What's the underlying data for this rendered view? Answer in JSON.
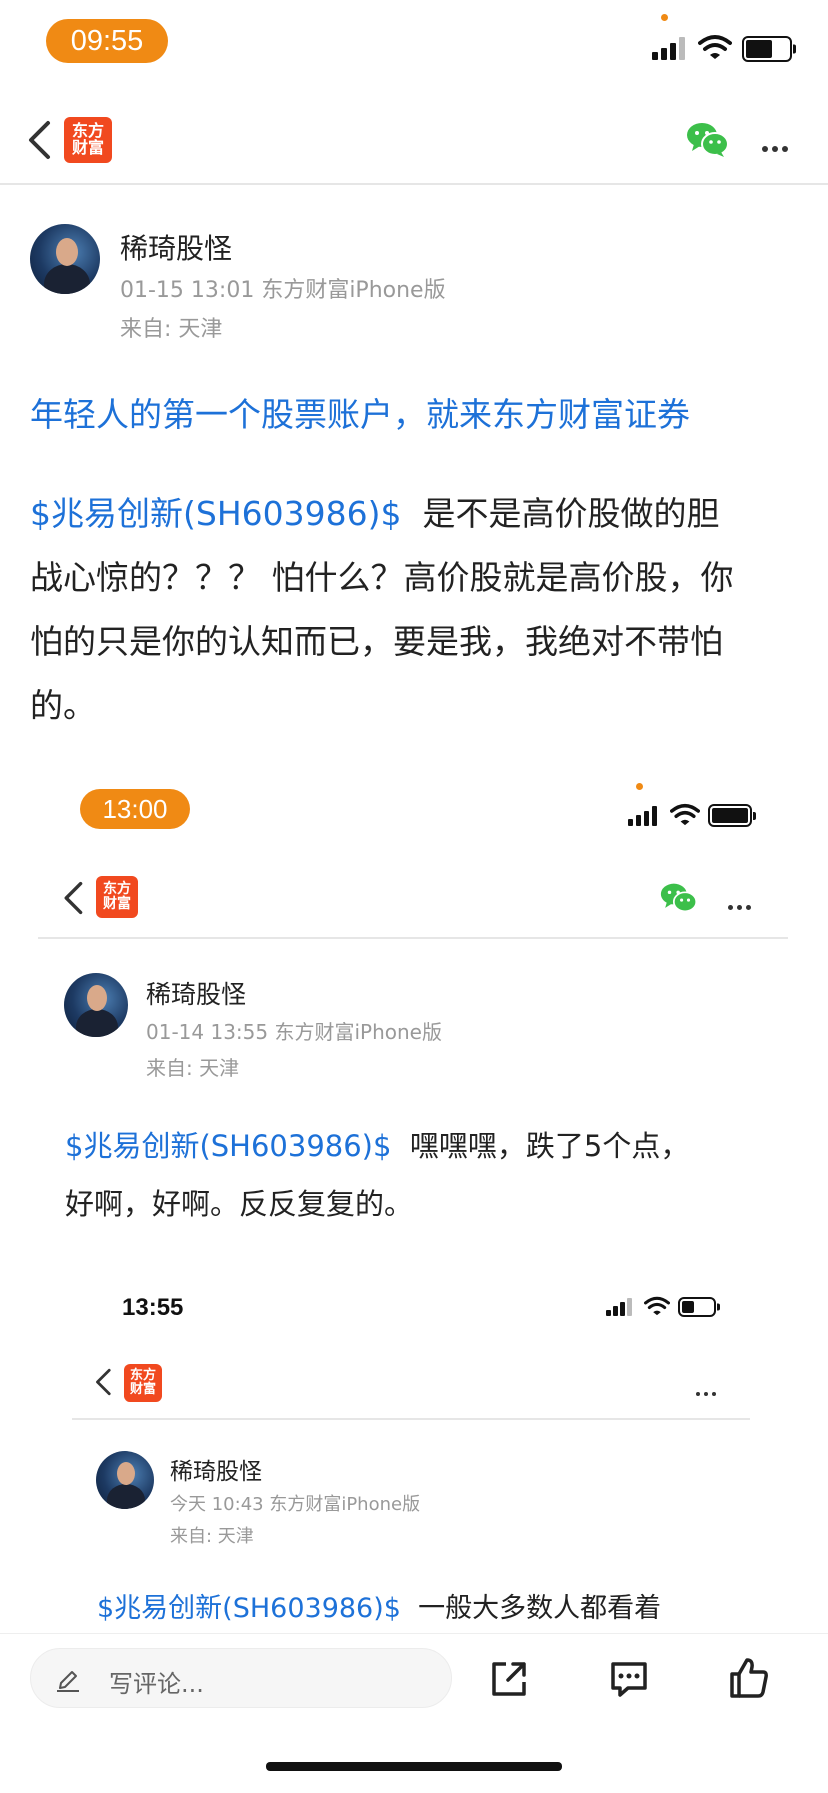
{
  "status": {
    "time": "09:55"
  },
  "nav": {
    "logo_line1": "东方",
    "logo_line2": "财富"
  },
  "post": {
    "author": "稀琦股怪",
    "meta": "01-15 13:01 东方财富iPhone版",
    "location": "来自: 天津",
    "promo": "年轻人的第一个股票账户，就来东方财富证券",
    "stock_tag": "$兆易创新(SH603986)$",
    "line1_rest": "是不是高价股做的胆",
    "line2": "战心惊的？？？ 怕什么？高价股就是高价股，你",
    "line3": "怕的只是你的认知而已，要是我，我绝对不带怕",
    "line4": "的。"
  },
  "shot1": {
    "time": "13:00",
    "logo_line1": "东方",
    "logo_line2": "财富",
    "author": "稀琦股怪",
    "meta": "01-14 13:55 东方财富iPhone版",
    "location": "来自: 天津",
    "stock_tag": "$兆易创新(SH603986)$",
    "line1_rest": "嘿嘿嘿，跌了5个点，",
    "line2": "好啊，好啊。反反复复的。"
  },
  "shot2": {
    "time": "13:55",
    "logo_line1": "东方",
    "logo_line2": "财富",
    "author": "稀琦股怪",
    "meta": "今天 10:43 东方财富iPhone版",
    "location": "来自: 天津",
    "stock_tag": "$兆易创新(SH603986)$",
    "line1_rest": "一般大多数人都看着"
  },
  "bottom": {
    "comment_placeholder": "写评论..."
  },
  "icons": {
    "back": "chevron-left-icon",
    "wechat": "wechat-icon",
    "more": "more-icon",
    "edit": "pencil-icon",
    "share": "share-icon",
    "comment": "comment-icon",
    "like": "thumbs-up-icon"
  },
  "colors": {
    "accent_orange": "#f08a14",
    "brand_red": "#f1491f",
    "link_blue": "#1d71d8",
    "wechat_green": "#3cbf4a"
  }
}
